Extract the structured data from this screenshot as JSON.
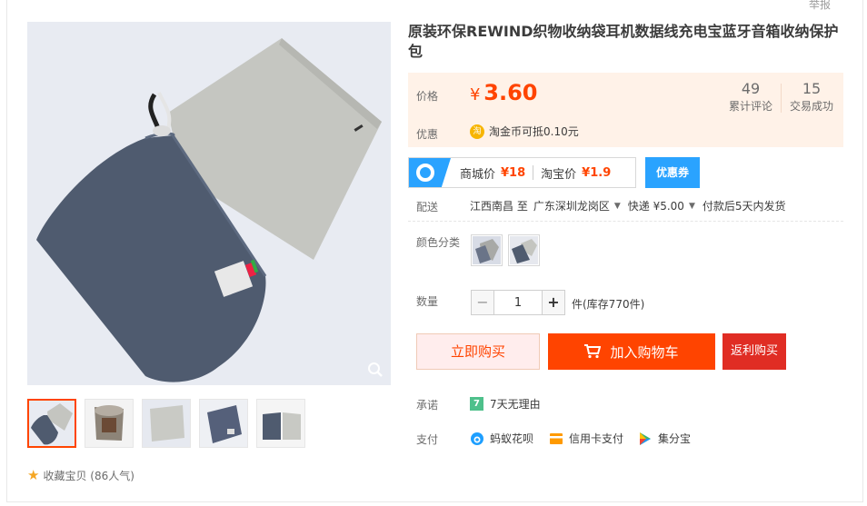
{
  "report_label": "举报",
  "product": {
    "title": "原装环保REWIND织物收纳袋耳机数据线充电宝蓝牙音箱收纳保护包"
  },
  "price_box": {
    "price_label": "价格",
    "currency": "¥",
    "price": "3.60",
    "reviews_count": "49",
    "reviews_label": "累计评论",
    "sold_count": "15",
    "sold_label": "交易成功",
    "promo_label": "优惠",
    "promo_icon_text": "淘",
    "promo_text": "淘金币可抵0.10元"
  },
  "compare": {
    "mall_label": "商城价",
    "mall_price": "¥18",
    "taobao_label": "淘宝价",
    "taobao_price": "¥1.9",
    "coupon_label": "优惠券"
  },
  "shipping": {
    "label": "配送",
    "from": "江西南昌 至",
    "to": "广东深圳龙岗区",
    "method": "快递 ¥5.00",
    "delivery": "付款后5天内发货"
  },
  "color": {
    "label": "颜色分类",
    "options": [
      "light-grey",
      "dark-blue"
    ]
  },
  "quantity": {
    "label": "数量",
    "value": "1",
    "minus": "−",
    "plus": "+",
    "stock": "件(库存770件)"
  },
  "actions": {
    "buy_now": "立即购买",
    "add_to_cart": "加入购物车",
    "rebate": "返利购买"
  },
  "promise": {
    "label": "承诺",
    "icon_text": "7",
    "text": "7天无理由"
  },
  "payment": {
    "label": "支付",
    "methods": [
      "蚂蚁花呗",
      "信用卡支付",
      "集分宝"
    ]
  },
  "gallery": {
    "favorite_text": "收藏宝贝 (86人气)",
    "thumb_count": 5
  },
  "colors": {
    "accent": "#ff4400",
    "price_bg": "#fff2e8",
    "blue": "#2aa3ff",
    "rebate": "#e02d24"
  }
}
